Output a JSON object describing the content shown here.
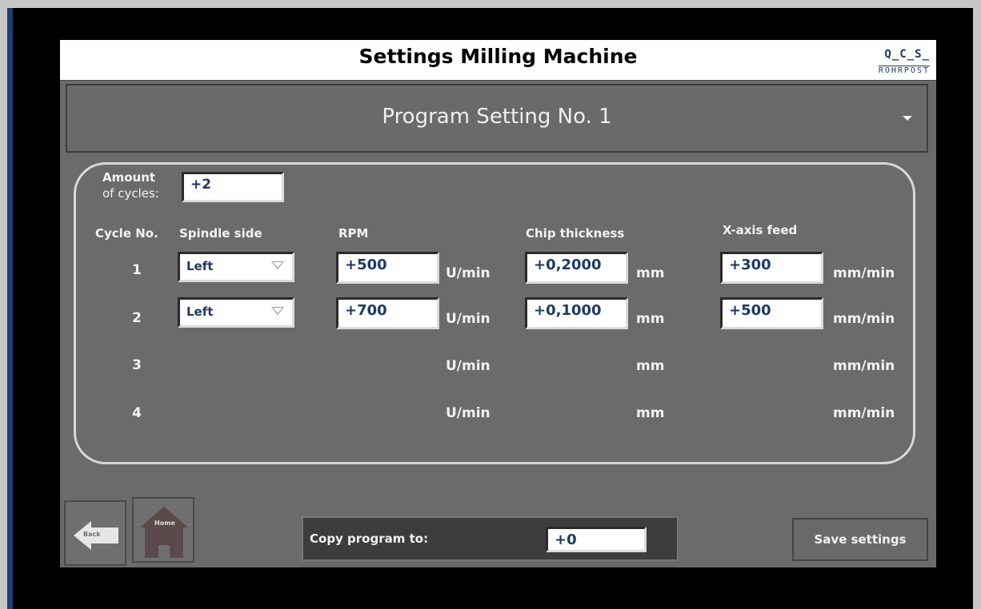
{
  "window": {
    "title": "Settings Milling Machine",
    "logo_line1": "Q_C_S_",
    "logo_line2": "ROHRPOST"
  },
  "program_selector": {
    "selected": "Program Setting No. 1",
    "icon": "chevron-down-icon"
  },
  "cycles": {
    "amount_label": "Amount of cycles:",
    "amount_label_line1": "Amount",
    "amount_label_line2": "of cycles:",
    "amount_value": "+2",
    "headers": {
      "cycle_no": "Cycle No.",
      "spindle_side": "Spindle side",
      "rpm": "RPM",
      "chip_thickness": "Chip thickness",
      "x_axis_feed": "X-axis feed"
    },
    "units": {
      "rpm": "U/min",
      "chip": "mm",
      "feed": "mm/min"
    },
    "rows": [
      {
        "no": "1",
        "spindle": "Left",
        "rpm": "+500",
        "chip": "+0,2000",
        "feed": "+300"
      },
      {
        "no": "2",
        "spindle": "Left",
        "rpm": "+700",
        "chip": "+0,1000",
        "feed": "+500"
      },
      {
        "no": "3"
      },
      {
        "no": "4"
      }
    ]
  },
  "footer": {
    "back_label": "Back",
    "home_label": "Home",
    "copy_label": "Copy program to:",
    "copy_value": "+0",
    "save_label": "Save settings"
  },
  "colors": {
    "panel": "#6b6b6b",
    "title_bar": "#ffffff",
    "frame": "#000000",
    "field_text": "#1d3a66"
  }
}
